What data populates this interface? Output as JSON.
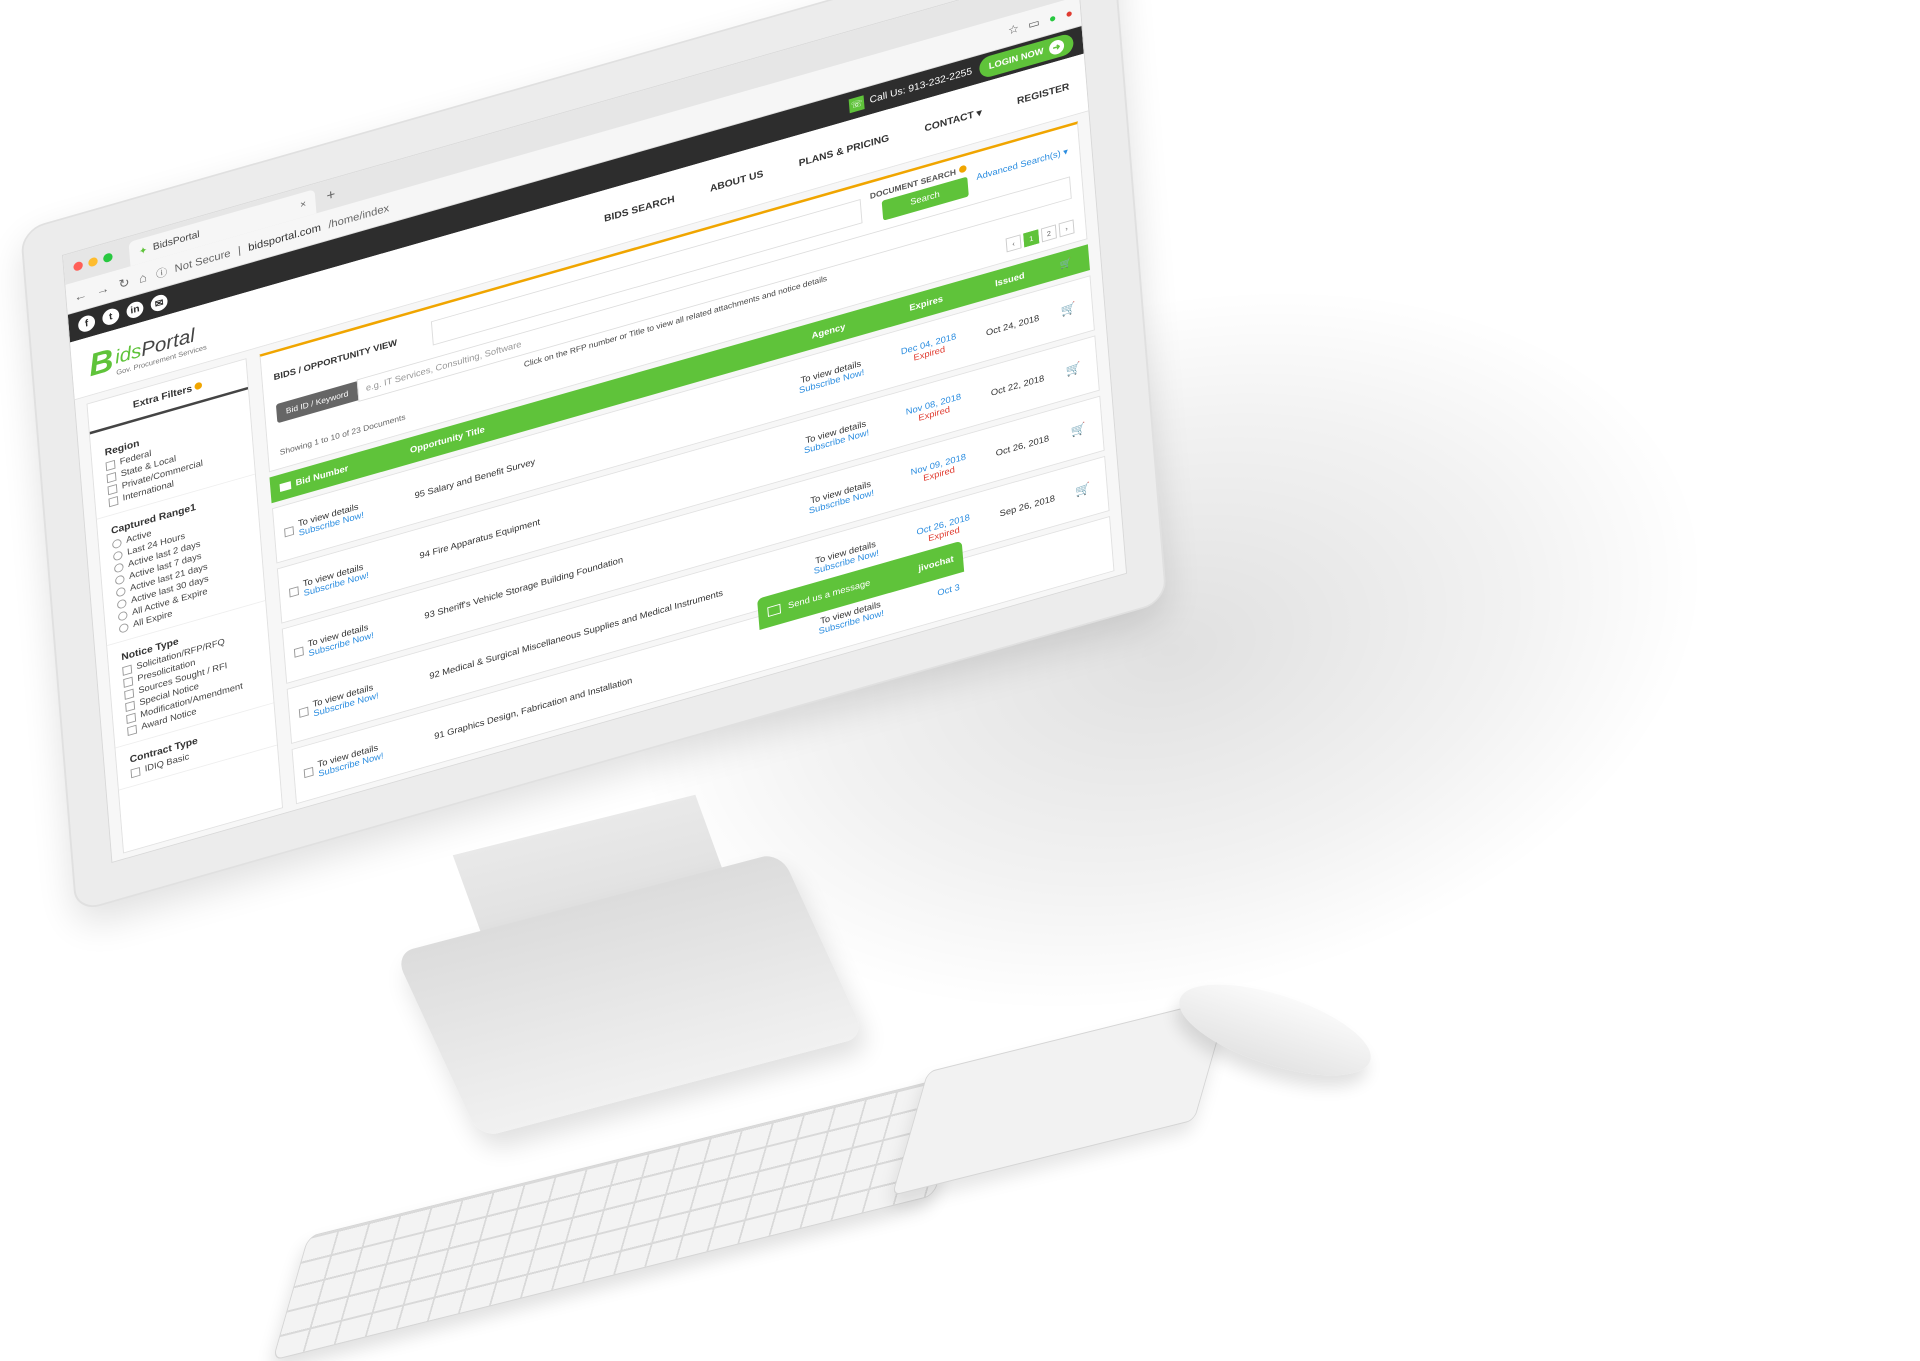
{
  "browser": {
    "tab_title": "BidsPortal",
    "tab_close": "×",
    "new_tab": "+",
    "security": "Not Secure",
    "url_host": "bidsportal.com",
    "url_path": "/home/index"
  },
  "topbar": {
    "social": [
      "f",
      "t",
      "in",
      "✉"
    ],
    "phone_label": "Call Us: 913-232-2255",
    "login_label": "LOGIN NOW"
  },
  "header": {
    "logo_b": "B",
    "logo_bids": "ids",
    "logo_portal": "Portal",
    "logo_tagline": "Gov. Procurement Services",
    "nav": [
      "BIDS SEARCH",
      "ABOUT US",
      "PLANS & PRICING",
      "CONTACT ▾",
      "REGISTER"
    ]
  },
  "sidebar": {
    "title": "Extra Filters",
    "region": {
      "title": "Region",
      "items": [
        "Federal",
        "State & Local",
        "Private/Commercial",
        "International"
      ]
    },
    "captured_range": {
      "title": "Captured Range1",
      "items": [
        "Active",
        "Last 24 Hours",
        "Active last 2 days",
        "Active last 7 days",
        "Active last 21 days",
        "Active last 30 days",
        "All Active & Expire",
        "All Expire"
      ]
    },
    "notice_type": {
      "title": "Notice Type",
      "items": [
        "Solicitation/RFP/RFQ",
        "Presolicitation",
        "Sources Sought / RFI",
        "Special Notice",
        "Modification/Amendment",
        "Award Notice"
      ]
    },
    "contract_type": {
      "title": "Contract Type",
      "items": [
        "IDIQ Basic"
      ]
    }
  },
  "search": {
    "view_title": "BIDS / OPPORTUNITY VIEW",
    "document_search": "DOCUMENT SEARCH",
    "search_button": "Search",
    "advanced_link": "Advanced Search(s) ▾",
    "keyword_tag": "Bid ID / Keyword",
    "keyword_placeholder": "e.g. IT Services, Consulting, Software",
    "helper_text": "Click on the RFP number or Title to view all related attachments and notice details",
    "showing": "Showing 1 to 10 of 23 Documents",
    "pages": [
      "‹",
      "1",
      "2",
      "›"
    ],
    "active_page": "1"
  },
  "table": {
    "headers": {
      "bid_number": "Bid Number",
      "title": "Opportunity Title",
      "agency": "Agency",
      "expires": "Expires",
      "issued": "Issued"
    },
    "rows": [
      {
        "detail": "To view details",
        "subscribe": "Subscribe Now!",
        "title": "95 Salary and Benefit Survey",
        "agency_detail": "To view details",
        "agency_sub": "Subscribe Now!",
        "expires": "Dec 04, 2018",
        "status": "Expired",
        "issued": "Oct 24, 2018"
      },
      {
        "detail": "To view details",
        "subscribe": "Subscribe Now!",
        "title": "94 Fire Apparatus Equipment",
        "agency_detail": "To view details",
        "agency_sub": "Subscribe Now!",
        "expires": "Nov 08, 2018",
        "status": "Expired",
        "issued": "Oct 22, 2018"
      },
      {
        "detail": "To view details",
        "subscribe": "Subscribe Now!",
        "title": "93 Sheriff's Vehicle Storage Building Foundation",
        "agency_detail": "To view details",
        "agency_sub": "Subscribe Now!",
        "expires": "Nov 09, 2018",
        "status": "Expired",
        "issued": "Oct 26, 2018"
      },
      {
        "detail": "To view details",
        "subscribe": "Subscribe Now!",
        "title": "92 Medical & Surgical Miscellaneous Supplies and Medical Instruments",
        "agency_detail": "To view details",
        "agency_sub": "Subscribe Now!",
        "expires": "Oct 26, 2018",
        "status": "Expired",
        "issued": "Sep 26, 2018"
      },
      {
        "detail": "To view details",
        "subscribe": "Subscribe Now!",
        "title": "91 Graphics Design, Fabrication and Installation",
        "agency_detail": "To view details",
        "agency_sub": "Subscribe Now!",
        "expires": "Oct 3",
        "status": "",
        "issued": ""
      }
    ]
  },
  "chat": {
    "label": "Send us a message",
    "brand": "jivochat"
  }
}
